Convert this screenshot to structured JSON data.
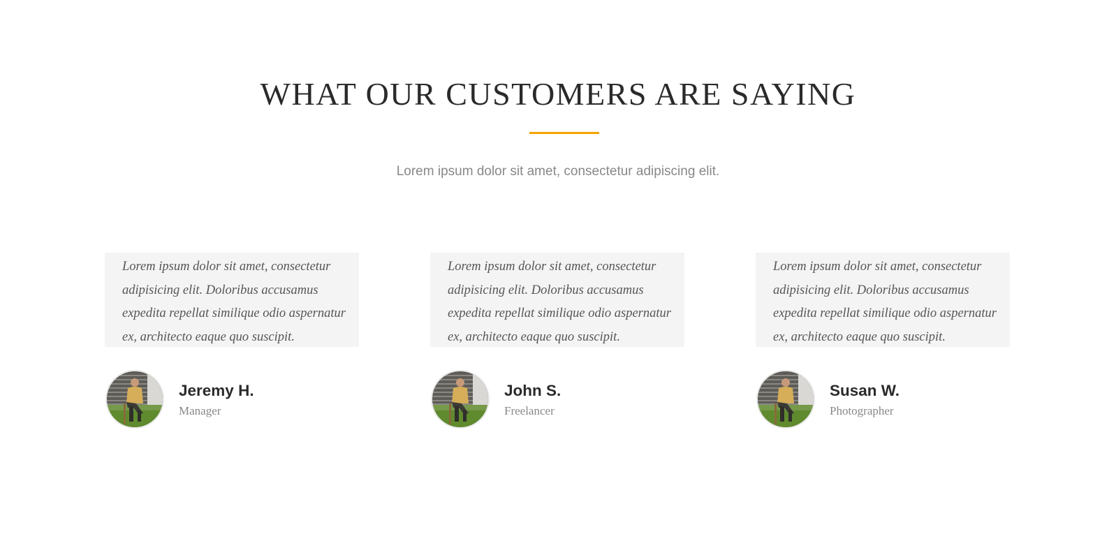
{
  "section": {
    "title": "WHAT OUR CUSTOMERS ARE SAYING",
    "subtitle": "Lorem ipsum dolor sit amet, consectetur adipiscing elit.",
    "accent_color": "#f5a300"
  },
  "testimonials": [
    {
      "quote": "Lorem ipsum dolor sit amet, consectetur adipisicing elit. Doloribus accusamus expedita repellat similique odio aspernatur ex, architecto eaque quo suscipit.",
      "name": "Jeremy H.",
      "role": "Manager",
      "avatar_icon": "person-photo"
    },
    {
      "quote": "Lorem ipsum dolor sit amet, consectetur adipisicing elit. Doloribus accusamus expedita repellat similique odio aspernatur ex, architecto eaque quo suscipit.",
      "name": "John S.",
      "role": "Freelancer",
      "avatar_icon": "person-photo"
    },
    {
      "quote": "Lorem ipsum dolor sit amet, consectetur adipisicing elit. Doloribus accusamus expedita repellat similique odio aspernatur ex, architecto eaque quo suscipit.",
      "name": "Susan W.",
      "role": "Photographer",
      "avatar_icon": "person-photo"
    }
  ]
}
